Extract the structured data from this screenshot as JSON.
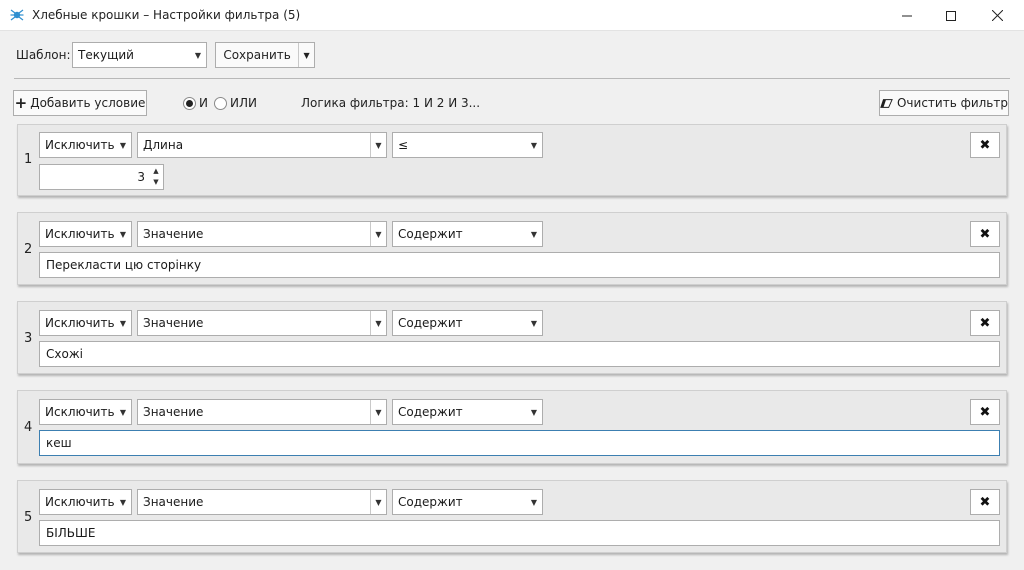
{
  "window": {
    "title": "Хлебные крошки – Настройки фильтра (5)"
  },
  "toolbar": {
    "template_label": "Шаблон:",
    "template_value": "Текущий",
    "save_label": "Сохранить"
  },
  "actions": {
    "add_condition": "Добавить условие",
    "and_label": "И",
    "or_label": "ИЛИ",
    "selected_logic": "И",
    "logic_text": "Логика фильтра: 1 И 2 И 3...",
    "clear_filter": "Очистить фильтр"
  },
  "conditions": [
    {
      "num": "1",
      "action": "Исключить",
      "field": "Длина",
      "op": "≤",
      "value": "3"
    },
    {
      "num": "2",
      "action": "Исключить",
      "field": "Значение",
      "op": "Содержит",
      "value": "Перекласти цю сторінку"
    },
    {
      "num": "3",
      "action": "Исключить",
      "field": "Значение",
      "op": "Содержит",
      "value": "Схожі"
    },
    {
      "num": "4",
      "action": "Исключить",
      "field": "Значение",
      "op": "Содержит",
      "value": "кеш"
    },
    {
      "num": "5",
      "action": "Исключить",
      "field": "Значение",
      "op": "Содержит",
      "value": "БІЛЬШЕ"
    }
  ],
  "colors": {
    "focus": "#3c7fb1",
    "panel_bg": "#e9e9e9",
    "window_bg": "#f0f0f0"
  }
}
